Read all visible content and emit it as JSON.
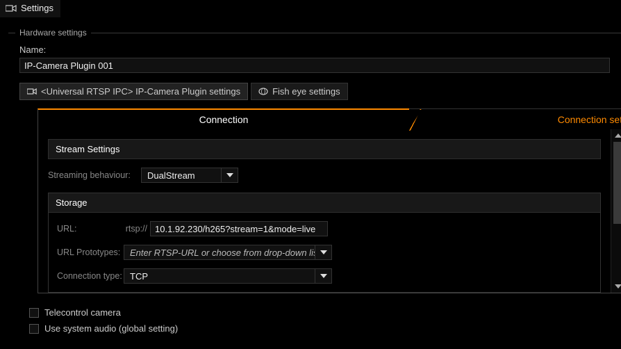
{
  "window": {
    "title": "Settings"
  },
  "hardware": {
    "legend": "Hardware settings",
    "name_label": "Name:",
    "name_value": "IP-Camera Plugin 001"
  },
  "mini_tabs": {
    "plugin": "<Universal RTSP IPC> IP-Camera Plugin settings",
    "fisheye": "Fish eye settings"
  },
  "big_tabs": {
    "left": "Connection",
    "right": "Connection sett"
  },
  "stream": {
    "heading": "Stream Settings",
    "behaviour_label": "Streaming behaviour:",
    "behaviour_value": "DualStream"
  },
  "storage": {
    "heading": "Storage",
    "url_label": "URL:",
    "url_prefix": "rtsp://",
    "url_value": "10.1.92.230/h265?stream=1&mode=live",
    "proto_label": "URL Prototypes:",
    "proto_placeholder": "Enter RTSP-URL or choose from drop-down list",
    "conn_label": "Connection type:",
    "conn_value": "TCP"
  },
  "checks": {
    "telecontrol": "Telecontrol camera",
    "system_audio": "Use system audio (global setting)"
  }
}
